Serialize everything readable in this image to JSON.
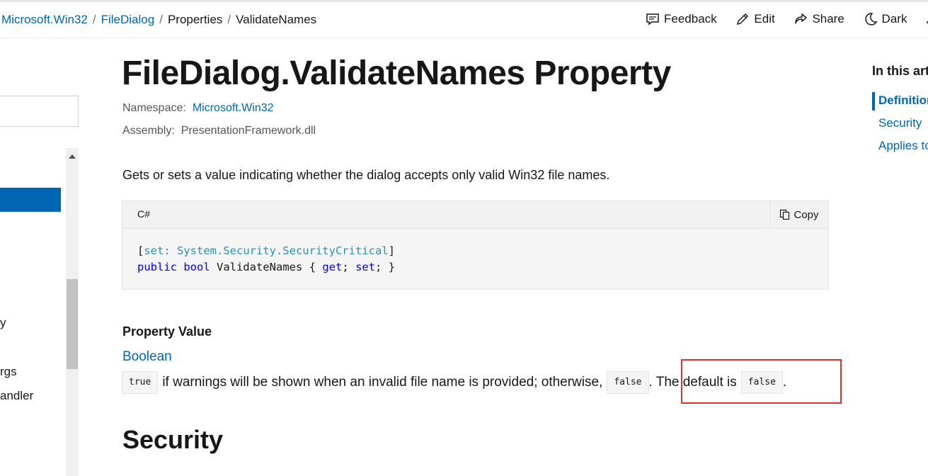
{
  "breadcrumb": {
    "items": [
      "Microsoft.Win32",
      "FileDialog",
      "Properties",
      "ValidateNames"
    ],
    "separator": "/"
  },
  "actions": {
    "feedback": "Feedback",
    "edit": "Edit",
    "share": "Share",
    "dark": "Dark",
    "embed_glyph": "</>"
  },
  "leftnav": {
    "partial_items": [
      "y",
      "rgs",
      "andler"
    ]
  },
  "article": {
    "title": "FileDialog.ValidateNames Property",
    "namespace_label": "Namespace:",
    "namespace_value": "Microsoft.Win32",
    "assembly_label": "Assembly:",
    "assembly_value": "PresentationFramework.dll",
    "summary": "Gets or sets a value indicating whether the dialog accepts only valid Win32 file names.",
    "code": {
      "language": "C#",
      "copy_label": "Copy",
      "line1": {
        "open_bracket": "[",
        "attr": "set: System.Security.SecurityCritical",
        "close_bracket": "]"
      },
      "line2": {
        "kw_public": "public",
        "kw_bool": "bool",
        "name": "ValidateNames",
        "open": "{",
        "kw_get": "get",
        "semi1": ";",
        "kw_set": "set",
        "close": "; }"
      }
    },
    "property_value_heading": "Property Value",
    "property_type": "Boolean",
    "value_desc": {
      "chip_true": "true",
      "text1": "if warnings will be shown when an invalid file name is provided; otherwise,",
      "chip_false": "false",
      "text2": ". The default is",
      "chip_false2": "false",
      "text3": "."
    },
    "security_heading": "Security"
  },
  "toc": {
    "title": "In this article",
    "items": [
      "Definition",
      "Security",
      "Applies to"
    ]
  },
  "colors": {
    "link": "#0065b3",
    "highlight_border": "#e0302d",
    "code_keyword": "#0000ff",
    "code_attribute": "#2b91af"
  }
}
